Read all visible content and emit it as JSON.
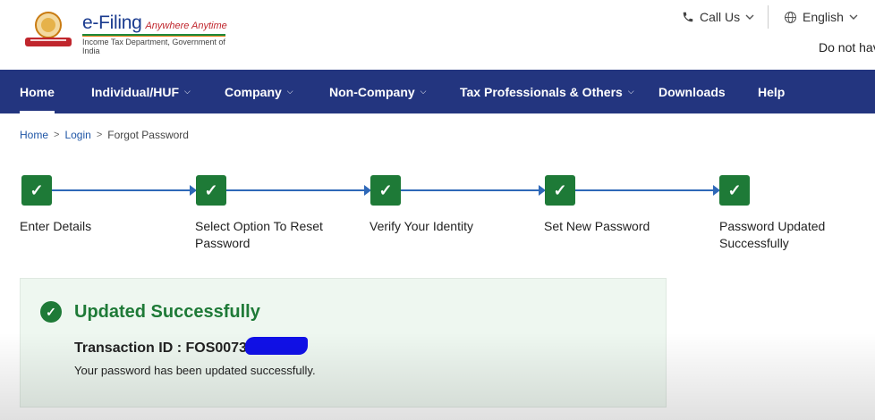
{
  "header": {
    "brand_title": "e-Filing",
    "brand_tagline": "Anywhere Anytime",
    "brand_subtitle": "Income Tax Department, Government of India",
    "call_us": "Call Us",
    "language": "English",
    "notice_text": "Do not hav",
    "icons": {
      "phone": "phone-icon",
      "globe": "globe-icon",
      "chevron": "chevron-down-icon"
    }
  },
  "nav": {
    "items": [
      {
        "label": "Home",
        "active": true,
        "has_dropdown": false
      },
      {
        "label": "Individual/HUF",
        "active": false,
        "has_dropdown": true
      },
      {
        "label": "Company",
        "active": false,
        "has_dropdown": true
      },
      {
        "label": "Non-Company",
        "active": false,
        "has_dropdown": true
      },
      {
        "label": "Tax Professionals & Others",
        "active": false,
        "has_dropdown": true
      },
      {
        "label": "Downloads",
        "active": false,
        "has_dropdown": false
      },
      {
        "label": "Help",
        "active": false,
        "has_dropdown": false
      }
    ]
  },
  "breadcrumb": {
    "items": [
      "Home",
      "Login"
    ],
    "current": "Forgot Password",
    "separator": ">"
  },
  "stepper": {
    "steps": [
      {
        "label_line1": "Enter Details",
        "label_line2": "",
        "status": "completed"
      },
      {
        "label_line1": "Select Option To Reset",
        "label_line2": "Password",
        "status": "completed"
      },
      {
        "label_line1": "Verify Your Identity",
        "label_line2": "",
        "status": "completed"
      },
      {
        "label_line1": "Set New Password",
        "label_line2": "",
        "status": "completed"
      },
      {
        "label_line1": "Password Updated",
        "label_line2": "Successfully",
        "status": "completed"
      }
    ],
    "check_glyph": "✓"
  },
  "result": {
    "title": "Updated Successfully",
    "transaction_label": "Transaction ID : FOS00732",
    "message": "Your password has been updated successfully."
  },
  "colors": {
    "nav_bg": "#23357f",
    "success_green": "#1e7a37",
    "link_blue": "#1f56a6",
    "panel_bg": "#eef7f0"
  }
}
